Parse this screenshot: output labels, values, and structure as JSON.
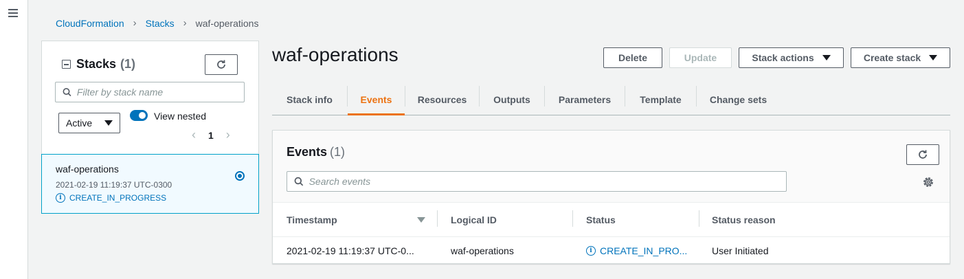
{
  "breadcrumb": [
    "CloudFormation",
    "Stacks",
    "waf-operations"
  ],
  "stacks_panel": {
    "title": "Stacks",
    "count": "(1)",
    "search_placeholder": "Filter by stack name",
    "filter_select": "Active",
    "view_nested_label": "View nested",
    "view_nested_on": true,
    "page": "1",
    "stacks": [
      {
        "name": "waf-operations",
        "timestamp": "2021-02-19 11:19:37 UTC-0300",
        "status": "CREATE_IN_PROGRESS",
        "selected": true
      }
    ]
  },
  "main": {
    "title": "waf-operations",
    "buttons": {
      "delete": "Delete",
      "update": "Update",
      "stack_actions": "Stack actions",
      "create_stack": "Create stack"
    },
    "tabs": [
      "Stack info",
      "Events",
      "Resources",
      "Outputs",
      "Parameters",
      "Template",
      "Change sets"
    ],
    "active_tab": "Events"
  },
  "events": {
    "title": "Events",
    "count": "(1)",
    "search_placeholder": "Search events",
    "columns": [
      "Timestamp",
      "Logical ID",
      "Status",
      "Status reason"
    ],
    "rows": [
      {
        "timestamp": "2021-02-19 11:19:37 UTC-0...",
        "logical_id": "waf-operations",
        "status": "CREATE_IN_PRO...",
        "status_reason": "User Initiated"
      }
    ]
  },
  "colors": {
    "link": "#0073bb",
    "active_tab": "#ec7211",
    "selected_border": "#00a1c9",
    "background": "#f2f3f3"
  }
}
